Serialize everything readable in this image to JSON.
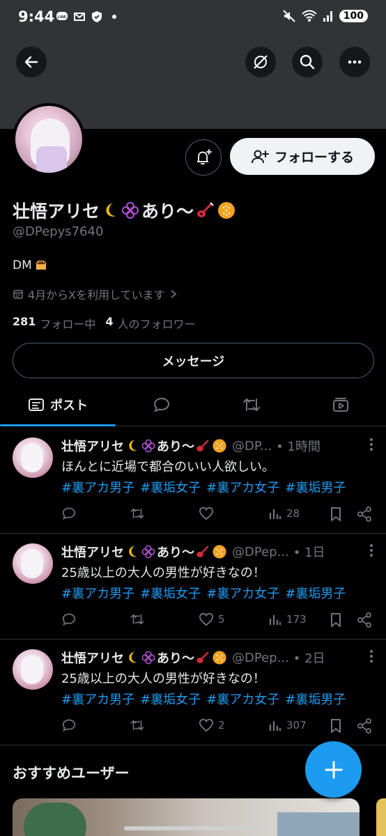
{
  "status_bar": {
    "time": "9:44",
    "battery": "100",
    "left_icons": [
      "line-icon",
      "mail-icon",
      "shield-icon",
      "dot-icon"
    ],
    "right_icons": [
      "mute-icon",
      "wifi-icon",
      "signal-icon"
    ]
  },
  "header": {
    "back_icon": "arrow-left-icon",
    "grok_icon": "slash-circle-icon",
    "search_icon": "search-icon",
    "more_icon": "more-dots-icon"
  },
  "profile": {
    "display_name": "壮悟アリセ",
    "name_tail": "あり〜",
    "handle": "@DPepys7640",
    "bio": "DM",
    "joined": "4月からXを利用しています",
    "following_count": "281",
    "following_label": "フォロー中",
    "followers_count": "4",
    "followers_label": "人のフォロワー",
    "follow_button": "フォローする",
    "message_button": "メッセージ"
  },
  "tabs": [
    {
      "label": "ポスト",
      "icon": "posts-icon",
      "active": true
    },
    {
      "label": "",
      "icon": "reply-icon",
      "active": false
    },
    {
      "label": "",
      "icon": "retweet-icon",
      "active": false
    },
    {
      "label": "",
      "icon": "media-icon",
      "active": false
    }
  ],
  "posts": [
    {
      "name": "壮悟アリセ",
      "name_tail": "あり〜",
      "handle": "@DP...",
      "time": "1時間",
      "text": "ほんとに近場で都合のいい人欲しい。",
      "tags": [
        "#裏アカ男子",
        "#裏垢女子",
        "#裏アカ女子",
        "#裏垢男子"
      ],
      "likes": "",
      "views": "28"
    },
    {
      "name": "壮悟アリセ",
      "name_tail": "あり〜",
      "handle": "@DPep...",
      "time": "1日",
      "text": "25歳以上の大人の男性が好きなの！",
      "tags": [
        "#裏アカ男子",
        "#裏垢女子",
        "#裏アカ女子",
        "#裏垢男子"
      ],
      "likes": "5",
      "views": "173"
    },
    {
      "name": "壮悟アリセ",
      "name_tail": "あり〜",
      "handle": "@DPep...",
      "time": "2日",
      "text": "25歳以上の大人の男性が好きなの！",
      "tags": [
        "#裏アカ男子",
        "#裏垢女子",
        "#裏アカ女子",
        "#裏垢男子"
      ],
      "likes": "2",
      "views": "307"
    }
  ],
  "recommend": {
    "title": "おすすめユーザー"
  },
  "colors": {
    "accent": "#1d9bf0",
    "background": "#000000",
    "banner": "#313335",
    "muted": "#71767b"
  }
}
